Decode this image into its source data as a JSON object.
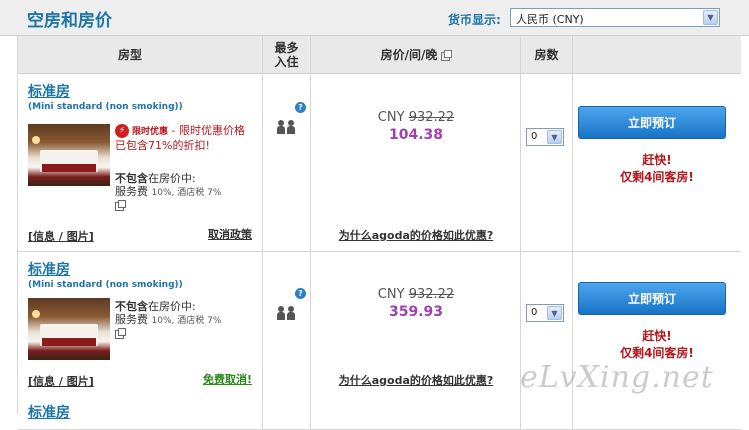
{
  "header": {
    "title": "空房和房价",
    "currency_label": "货币显示:",
    "currency_value": "人民币 (CNY)"
  },
  "table_headers": {
    "room_type": "房型",
    "max_guests_line1": "最多",
    "max_guests_line2": "入住",
    "price": "房价/间/晚",
    "rooms": "房数"
  },
  "rooms": [
    {
      "name": "标准房",
      "subtitle": "(Mini standard (non smoking))",
      "promo_tag": "限时优惠",
      "promo_text": " - 限时优惠价格已包含71%的折扣!",
      "tax_not_included": "不包含",
      "tax_in_price": "在房价中:",
      "tax_detail_1": "服务费",
      "tax_detail_2": "10%, 酒店税  7%",
      "info_label": "[信息 / 图片]",
      "policy_link": "取消政策",
      "currency": "CNY",
      "old_price": "932.22",
      "new_price": "104.38",
      "why_link": "为什么agoda的价格如此优惠?",
      "quantity": "0",
      "book_label": "立即预订",
      "hurry_line1": "赶快!",
      "hurry_line2": "仅剩4间客房!"
    },
    {
      "name": "标准房",
      "subtitle": "(Mini standard (non smoking))",
      "tax_not_included": "不包含",
      "tax_in_price": "在房价中:",
      "tax_detail_1": "服务费",
      "tax_detail_2": "10%, 酒店税  7%",
      "info_label": "[信息 / 图片]",
      "policy_link": "免费取消!",
      "currency": "CNY",
      "old_price": "932.22",
      "new_price": "359.93",
      "why_link": "为什么agoda的价格如此优惠?",
      "quantity": "0",
      "book_label": "立即预订",
      "hurry_line1": "赶快!",
      "hurry_line2": "仅剩4间客房!"
    },
    {
      "name": "标准房"
    }
  ],
  "watermark": "eLvXing.net",
  "colors": {
    "link_blue": "#1d74a8",
    "price_purple": "#a040b0",
    "alert_red": "#b4161b",
    "free_cancel_green": "#2b8a1a",
    "button_blue": "#1873c6"
  }
}
